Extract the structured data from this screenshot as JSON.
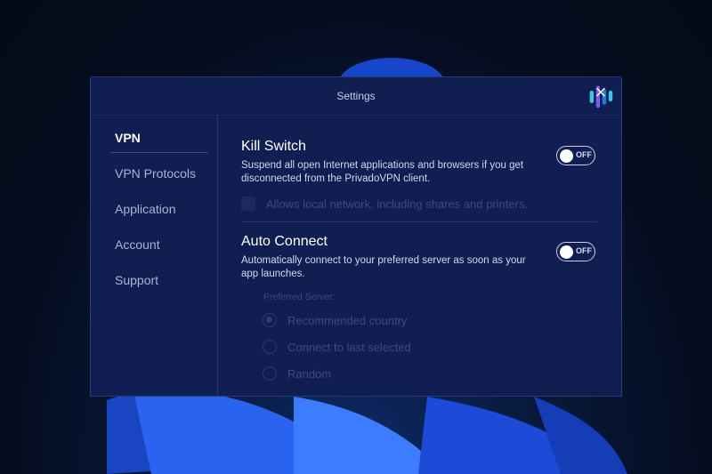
{
  "window": {
    "title": "Settings"
  },
  "sidebar": {
    "items": [
      {
        "label": "VPN",
        "active": true
      },
      {
        "label": "VPN Protocols"
      },
      {
        "label": "Application"
      },
      {
        "label": "Account"
      },
      {
        "label": "Support"
      }
    ]
  },
  "kill_switch": {
    "title": "Kill Switch",
    "description": "Suspend all open Internet applications and browsers if you get disconnected from the PrivadoVPN client.",
    "toggle_state": "OFF",
    "lan_option": "Allows local network, including shares and printers."
  },
  "auto_connect": {
    "title": "Auto Connect",
    "description": "Automatically connect to your preferred server as soon as your app launches.",
    "toggle_state": "OFF",
    "preferred_label": "Preferred Server:",
    "options": [
      "Recommended country",
      "Connect to last selected",
      "Random"
    ],
    "selected_option": "Recommended country"
  },
  "colors": {
    "window_bg": "#101e52",
    "accent_logo": [
      "#3ec6e0",
      "#7b5cf0",
      "#2a7bd8"
    ]
  }
}
